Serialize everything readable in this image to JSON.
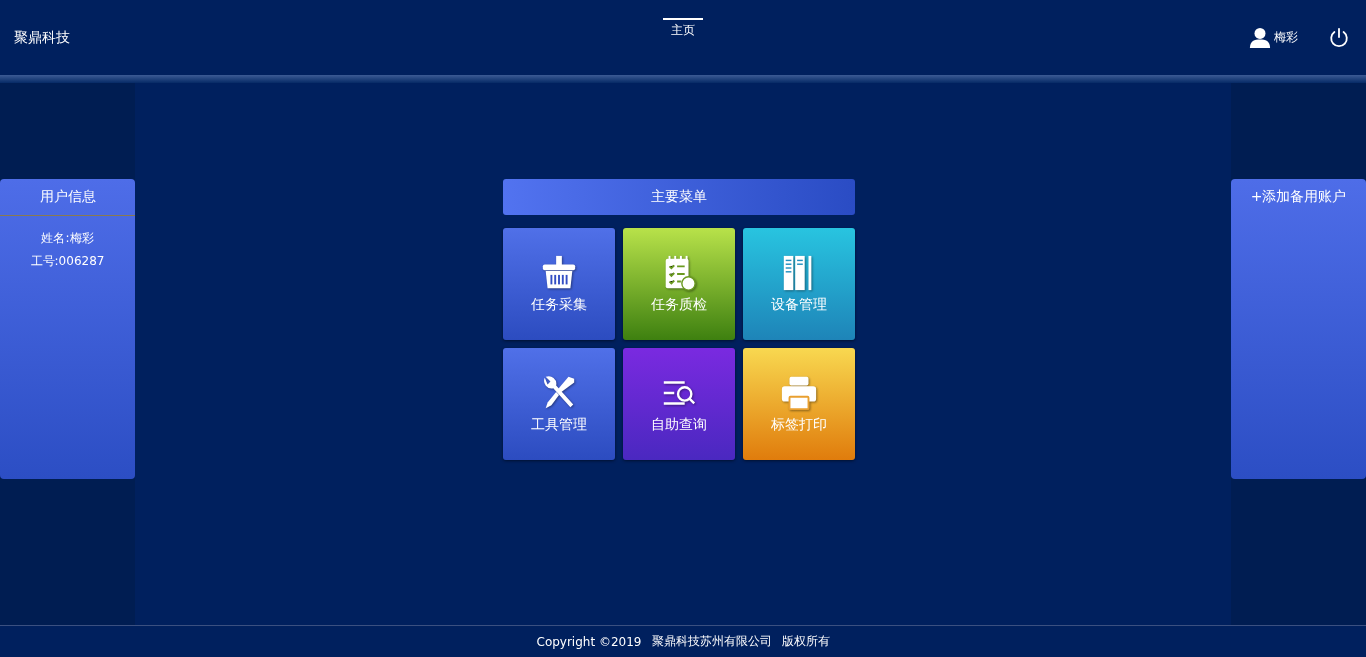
{
  "header": {
    "brand": "聚鼎科技",
    "nav": [
      {
        "label": "主页",
        "selected": true
      }
    ],
    "user": {
      "name": "梅彩"
    }
  },
  "user_panel": {
    "title": "用户信息",
    "lines": [
      "姓名:梅彩",
      "工号:006287"
    ]
  },
  "menu": {
    "title": "主要菜单",
    "tiles": [
      {
        "label": "任务采集",
        "kind": "basket",
        "color": "#5070e8"
      },
      {
        "label": "任务质检",
        "kind": "checklist",
        "color": "#b8e24a"
      },
      {
        "label": "设备管理",
        "kind": "server",
        "color": "#28c4e0"
      },
      {
        "label": "工具管理",
        "kind": "tools",
        "color": "#5070e8"
      },
      {
        "label": "自助查询",
        "kind": "search",
        "color": "#7a2ae0"
      },
      {
        "label": "标签打印",
        "kind": "printer",
        "color": "#f8d850"
      }
    ]
  },
  "account_panel": {
    "title": "+添加备用账户"
  },
  "footer": [
    "Copyright ©2019",
    "聚鼎科技苏州有限公司",
    "版权所有"
  ]
}
